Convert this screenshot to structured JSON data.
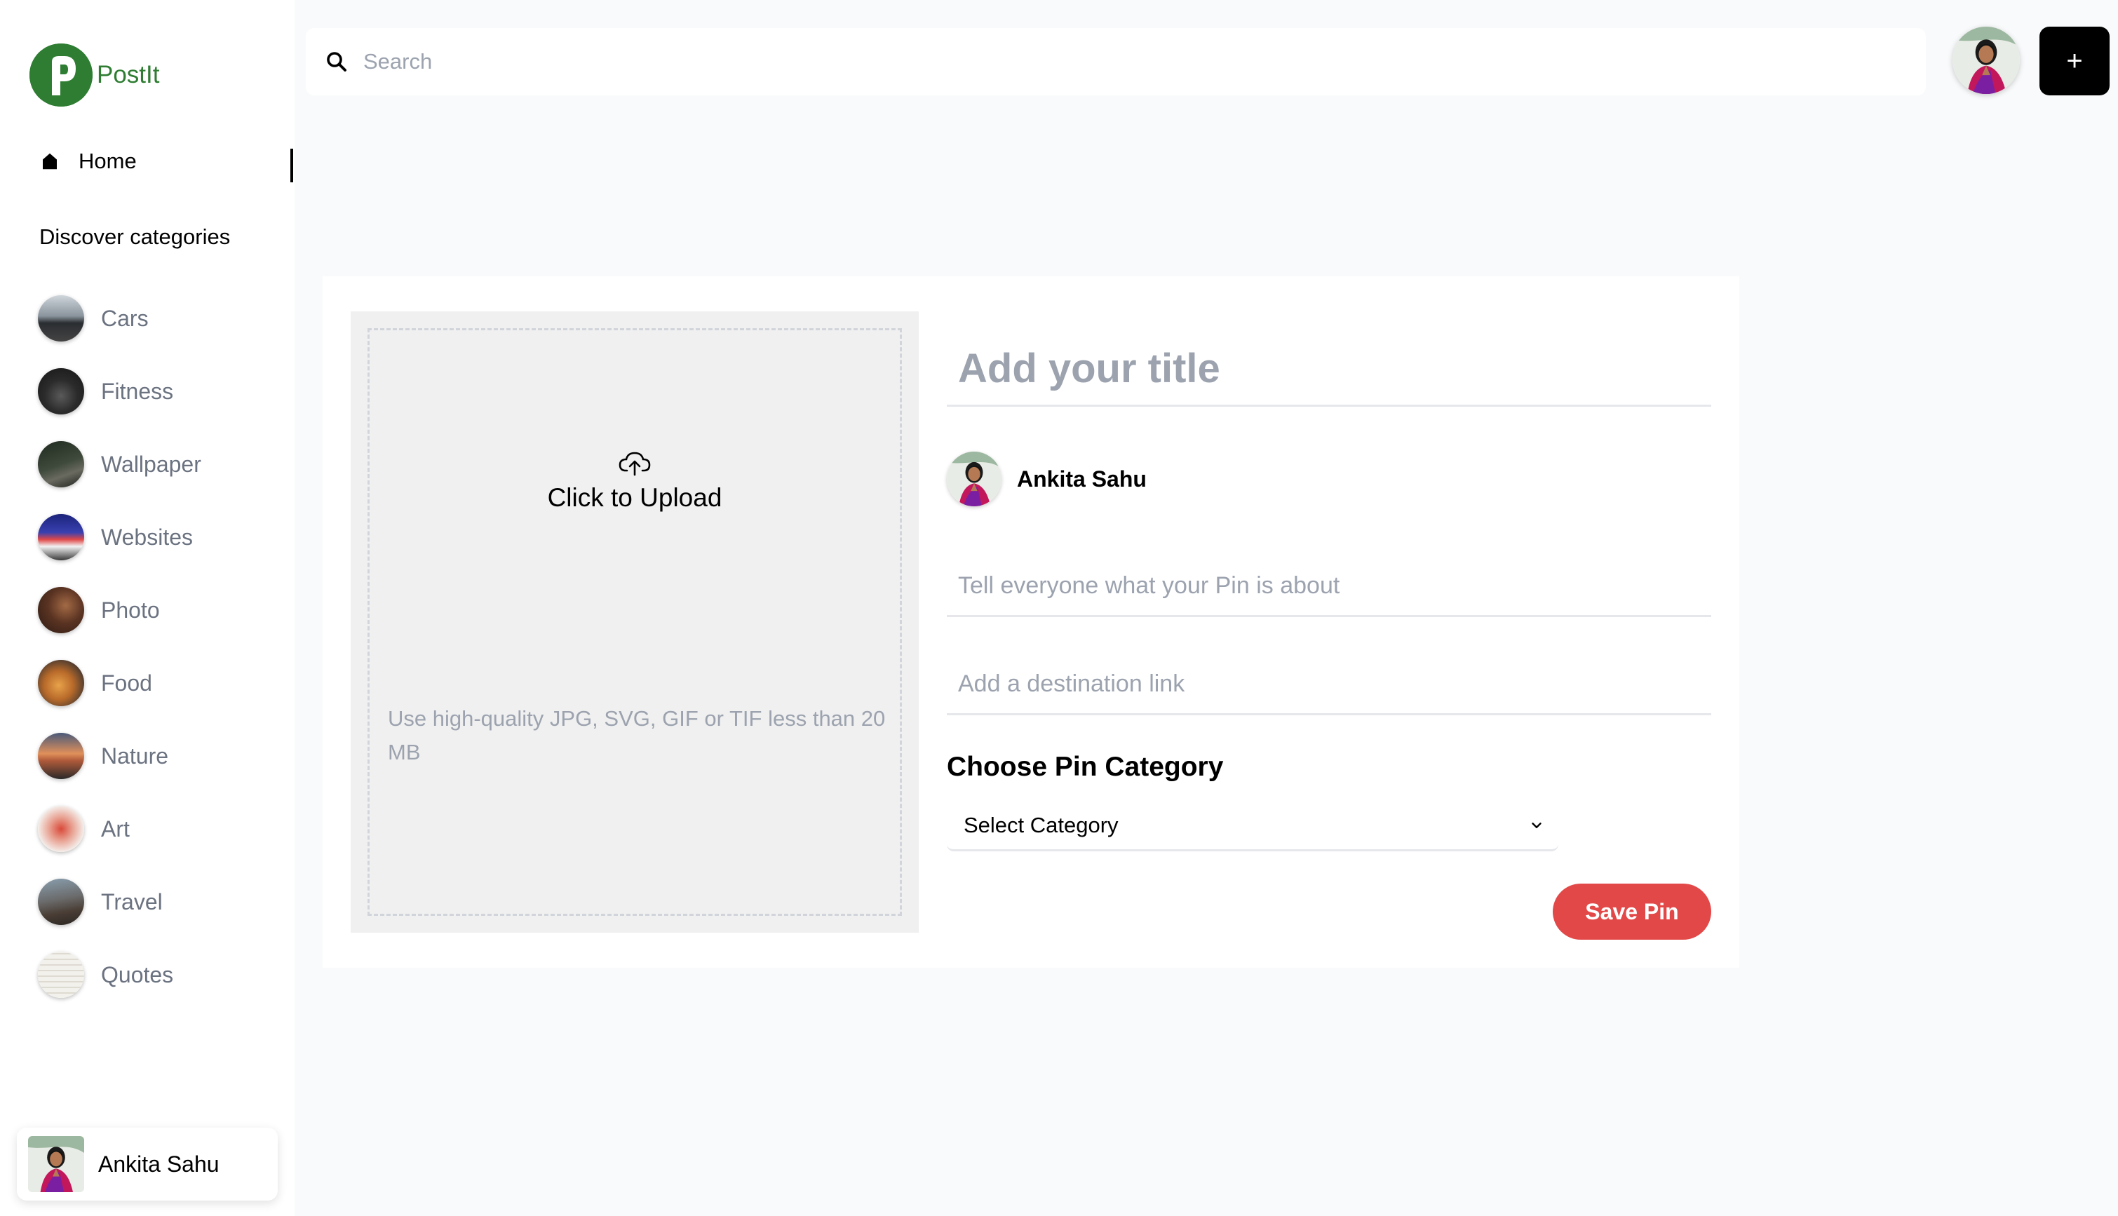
{
  "brand": {
    "name": "PostIt",
    "color": "#2e7d32"
  },
  "sidebar": {
    "home_label": "Home",
    "discover_heading": "Discover categories",
    "categories": [
      {
        "label": "Cars",
        "icon": "car-thumbnail"
      },
      {
        "label": "Fitness",
        "icon": "fitness-thumbnail"
      },
      {
        "label": "Wallpaper",
        "icon": "wallpaper-thumbnail"
      },
      {
        "label": "Websites",
        "icon": "websites-thumbnail"
      },
      {
        "label": "Photo",
        "icon": "photo-thumbnail"
      },
      {
        "label": "Food",
        "icon": "food-thumbnail"
      },
      {
        "label": "Nature",
        "icon": "nature-thumbnail"
      },
      {
        "label": "Art",
        "icon": "art-thumbnail"
      },
      {
        "label": "Travel",
        "icon": "travel-thumbnail"
      },
      {
        "label": "Quotes",
        "icon": "quotes-thumbnail"
      }
    ],
    "user_name": "Ankita Sahu"
  },
  "header": {
    "search_placeholder": "Search",
    "add_label": "+"
  },
  "upload": {
    "label": "Click to Upload",
    "hint": "Use high-quality JPG, SVG, GIF or TIF less than 20 MB"
  },
  "form": {
    "title_placeholder": "Add your title",
    "author_name": "Ankita Sahu",
    "about_placeholder": "Tell everyone what your Pin is about",
    "link_placeholder": "Add a destination link",
    "category_heading": "Choose Pin Category",
    "category_value": "Select Category",
    "save_label": "Save Pin",
    "save_color": "#e34848"
  }
}
